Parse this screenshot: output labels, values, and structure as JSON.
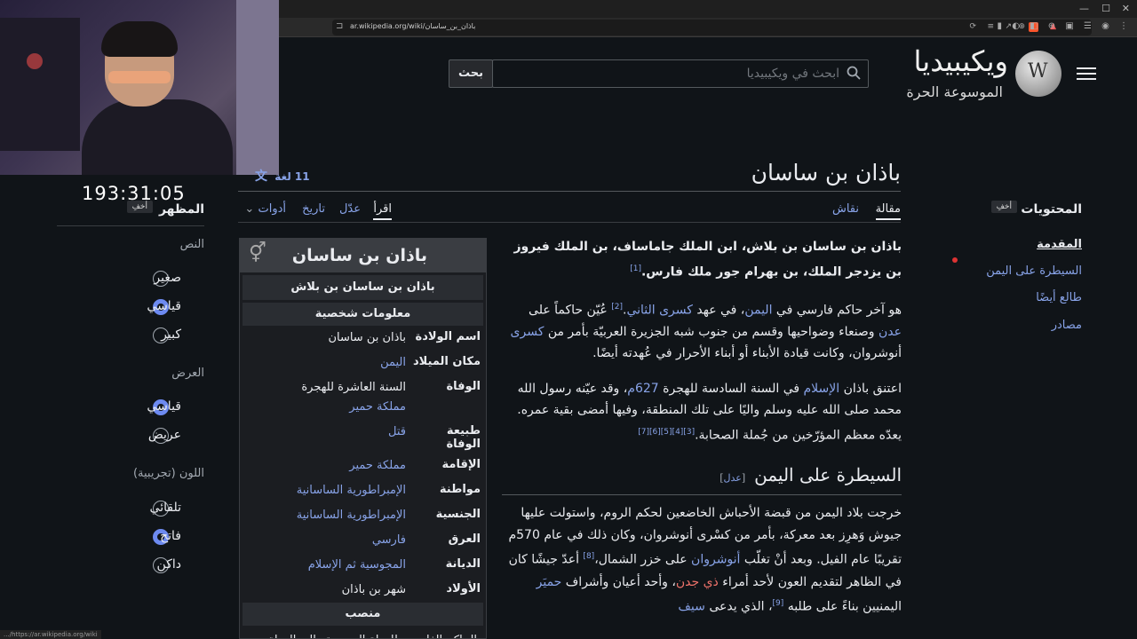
{
  "browser": {
    "url": "ar.wikipedia.org/wiki/باذان_بن_ساسان"
  },
  "stream": {
    "timer": "193:31:05"
  },
  "site": {
    "wordmark": "ويكيبيديا",
    "tagline": "الموسوعة الحرة",
    "search_placeholder": "ابحث في ويكيبيديا",
    "search_button": "بحث"
  },
  "page": {
    "title": "باذان بن ساسان",
    "languages": "11 لغة",
    "tabs": {
      "article": "مقالة",
      "talk": "نقاش",
      "read": "اقرأ",
      "edit": "عدّل",
      "history": "تاريخ",
      "tools": "أدوات"
    }
  },
  "toc": {
    "title": "المحتويات",
    "hide": "أخفِ",
    "items": [
      "المقدمة",
      "السيطرة على اليمن",
      "طالع أيضًا",
      "مصادر"
    ]
  },
  "appearance": {
    "title": "المظهر",
    "hide": "أخفِ",
    "text_label": "النص",
    "text_options": [
      "صغير",
      "قياسي",
      "كبير"
    ],
    "text_selected": 1,
    "width_label": "العرض",
    "width_options": [
      "قياسي",
      "عريض"
    ],
    "width_selected": 0,
    "color_label": "اللون (تجريبية)",
    "color_options": [
      "تلقائي",
      "فاتح",
      "داكن"
    ],
    "color_selected": 1
  },
  "infobox": {
    "name": "باذان بن ساسان",
    "full_name": "باذان بن ساسان بن بلاش",
    "section_personal": "معلومات شخصية",
    "rows": [
      {
        "k": "اسم الولادة",
        "v": [
          "باذان بن ساسان"
        ],
        "link": [
          false
        ]
      },
      {
        "k": "مكان الميلاد",
        "v": [
          "اليمن"
        ],
        "link": [
          true
        ]
      },
      {
        "k": "الوفاة",
        "v": [
          "السنة العاشرة للهجرة",
          "مملكة حمير"
        ],
        "link": [
          false,
          true
        ]
      },
      {
        "k": "طبيعة الوفاة",
        "v": [
          "قتل"
        ],
        "link": [
          true
        ]
      },
      {
        "k": "الإقامة",
        "v": [
          "مملكة حمير"
        ],
        "link": [
          true
        ]
      },
      {
        "k": "مواطنة",
        "v": [
          "الإمبراطورية الساسانية"
        ],
        "link": [
          true
        ]
      },
      {
        "k": "الجنسية",
        "v": [
          "الإمبراطورية الساسانية"
        ],
        "link": [
          true
        ]
      },
      {
        "k": "العرق",
        "v": [
          "فارسي"
        ],
        "link": [
          true
        ]
      },
      {
        "k": "الديانة",
        "v": [
          "المجوسية ثم الإسلام"
        ],
        "link": [
          true
        ]
      },
      {
        "k": "الأولاد",
        "v": [
          "شهر بن باذان"
        ],
        "link": [
          false
        ]
      }
    ],
    "section_office": "منصب",
    "office_text": "الحاكم الفارسي للدولة الحميرية والي الدولة"
  },
  "article": {
    "p1": "باذان بن ساسان بن بلاش، ابن الملك جاماساف، بن الملك فيروز بن يزدجر الملك، بن بهرام جور ملك فارس.",
    "p1_ref": "[1]",
    "p2a": "هو آخر حاكم فارسي في ",
    "p2_link1": "اليمن",
    "p2b": "، في عهد ",
    "p2_link2": "كسرى الثاني",
    "p2c": ".",
    "p2_ref": "[2]",
    "p2d": " عُيّن حاكماً على ",
    "p2_link3": "عدن",
    "p2e": " وصنعاء وضواحيها وقسم من جنوب شبه الجزيرة العربيّة بأمر من ",
    "p2_link4": "كسرى",
    "p2f": " أنوشروان، وكانت قيادة الأبناء أو أبناء الأحرار في عُهدته أيضًا.",
    "p3a": "اعتنق باذان ",
    "p3_link1": "الإسلام",
    "p3b": " في السنة السادسة للهجرة ",
    "p3_link2": "627م",
    "p3c": "، وقد عيّنه رسول الله محمد صلى الله عليه وسلم واليًا على تلك المنطقة، وفيها أمضى بقية عمره. يعدّه معظم المؤرّخين من جُملة الصحابة.",
    "p3_refs": "[3][4][5][6][7]",
    "h2": "السيطرة على اليمن",
    "edit_open": "[",
    "edit": "عدل",
    "edit_close": "]",
    "p4a": "خرجت بلاد اليمن من قبضة الأحباش الخاضعين لحكم الروم، واستولت عليها جيوش وَهرِز بعد معركة، بأمر من كسْرى أنوشروان، وكان ذلك في عام 570م تقريبًا عام الفيل. وبعد أنْ تغلّب ",
    "p4_link1": "أنوشروان",
    "p4b": " على خزر الشمال،",
    "p4_ref1": "[8]",
    "p4c": " أعدّ جيشًا كان في الظاهر لتقديم العون لأحد أمراء ",
    "p4_link2": "ذي جدن",
    "p4d": "، وأحد أعيان وأشراف ",
    "p4_link3": "حميَر",
    "p4e": " اليمنيين بناءً على طلبه ",
    "p4_ref2": "[9]",
    "p4f": "، الذي يدعى ",
    "p4_link4": "سيف"
  },
  "colors": {
    "background": "#101418",
    "link": "#88a3e8",
    "redlink": "#f0736b",
    "radio_on": "#6d8af0"
  }
}
